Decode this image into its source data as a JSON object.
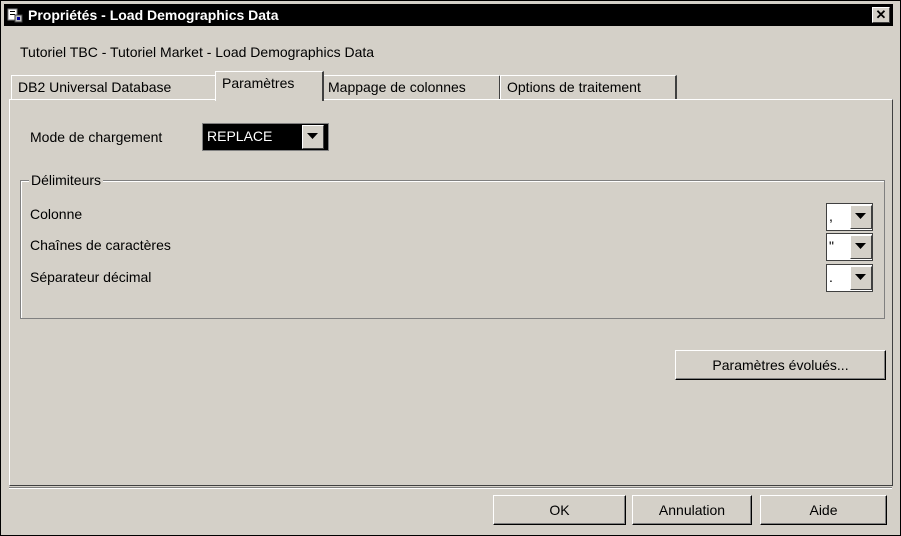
{
  "window": {
    "title": "Propriétés - Load Demographics Data",
    "close_label": "✕"
  },
  "breadcrumb": "Tutoriel TBC - Tutoriel Market - Load Demographics Data",
  "tabs": [
    {
      "label": "DB2 Universal Database",
      "active": false
    },
    {
      "label": "Paramètres",
      "active": true
    },
    {
      "label": "Mappage de colonnes",
      "active": false
    },
    {
      "label": "Options de traitement",
      "active": false
    }
  ],
  "load_mode": {
    "label": "Mode de chargement",
    "value": "REPLACE"
  },
  "delimiters": {
    "title": "Délimiteurs",
    "column": {
      "label": "Colonne",
      "value": ","
    },
    "string": {
      "label": "Chaînes de caractères",
      "value": "\""
    },
    "decimal": {
      "label": "Séparateur décimal",
      "value": "."
    }
  },
  "buttons": {
    "advanced": "Paramètres évolués...",
    "ok": "OK",
    "cancel": "Annulation",
    "help": "Aide"
  },
  "icons": {
    "title": "properties-icon",
    "close": "close-icon",
    "dropdown": "chevron-down-icon"
  }
}
